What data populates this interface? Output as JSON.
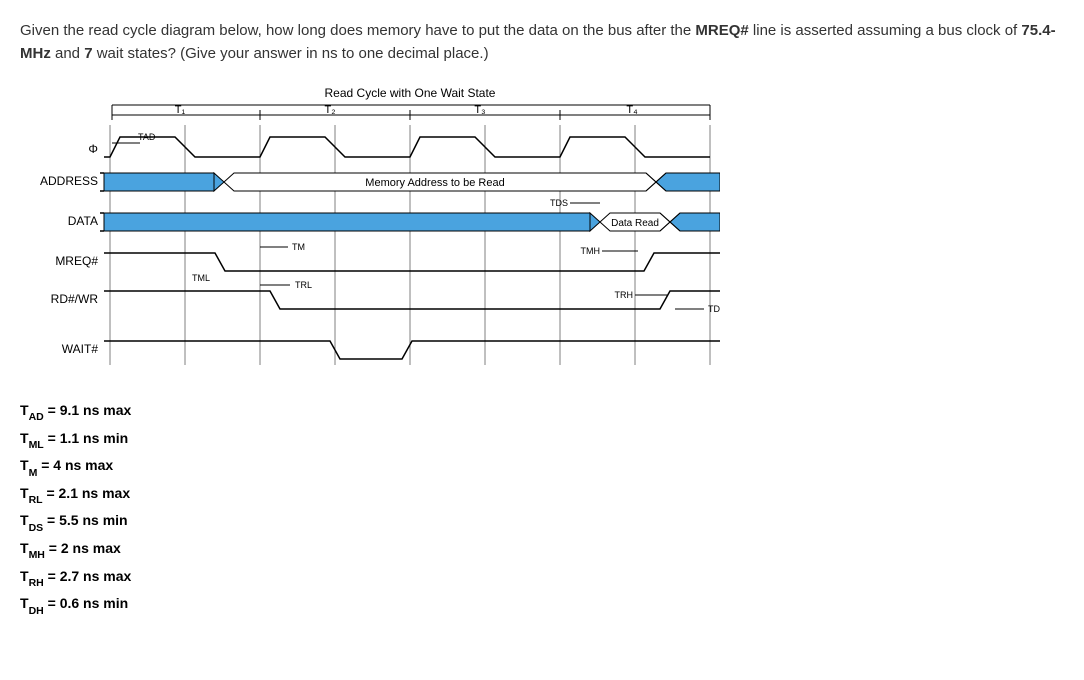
{
  "question": {
    "prefix": "Given the read cycle diagram below, how long does memory have to put the data on the bus after the ",
    "signal": "MREQ#",
    "mid": " line is asserted assuming a bus clock of ",
    "clock": "75.4-MHz",
    "and": " and ",
    "waits": "7",
    "suffix": " wait states? (Give your answer in ns to one decimal place.)"
  },
  "diagram": {
    "title": "Read Cycle with One Wait State",
    "tlabels": {
      "t1": "T₁",
      "t2": "T₂",
      "t3": "T₃",
      "t4": "T₄"
    },
    "signals": {
      "phi": "Φ",
      "address": "ADDRESS",
      "data": "DATA",
      "mreq": "MREQ#",
      "rdwr": "RD#/WR",
      "wait": "WAIT#"
    },
    "annot": {
      "tad": "TAD",
      "mem_addr": "Memory Address to be Read",
      "tds": "TDS",
      "data_read": "Data Read",
      "tml": "TML",
      "tm": "TM",
      "tmh": "TMH",
      "trl": "TRL",
      "trh": "TRH",
      "tdh": "TDH"
    }
  },
  "params": {
    "tad": {
      "sym": "T",
      "sub": "AD",
      "val": "= 9.1 ns max"
    },
    "tml": {
      "sym": "T",
      "sub": "ML",
      "val": "= 1.1 ns min"
    },
    "tm": {
      "sym": "T",
      "sub": "M",
      "val": "= 4 ns max"
    },
    "trl": {
      "sym": "T",
      "sub": "RL",
      "val": "= 2.1 ns max"
    },
    "tds": {
      "sym": "T",
      "sub": "DS",
      "val": "= 5.5 ns min"
    },
    "tmh": {
      "sym": "T",
      "sub": "MH",
      "val": "= 2 ns max"
    },
    "trh": {
      "sym": "T",
      "sub": "RH",
      "val": "= 2.7 ns max"
    },
    "tdh": {
      "sym": "T",
      "sub": "DH",
      "val": "= 0.6 ns min"
    }
  }
}
